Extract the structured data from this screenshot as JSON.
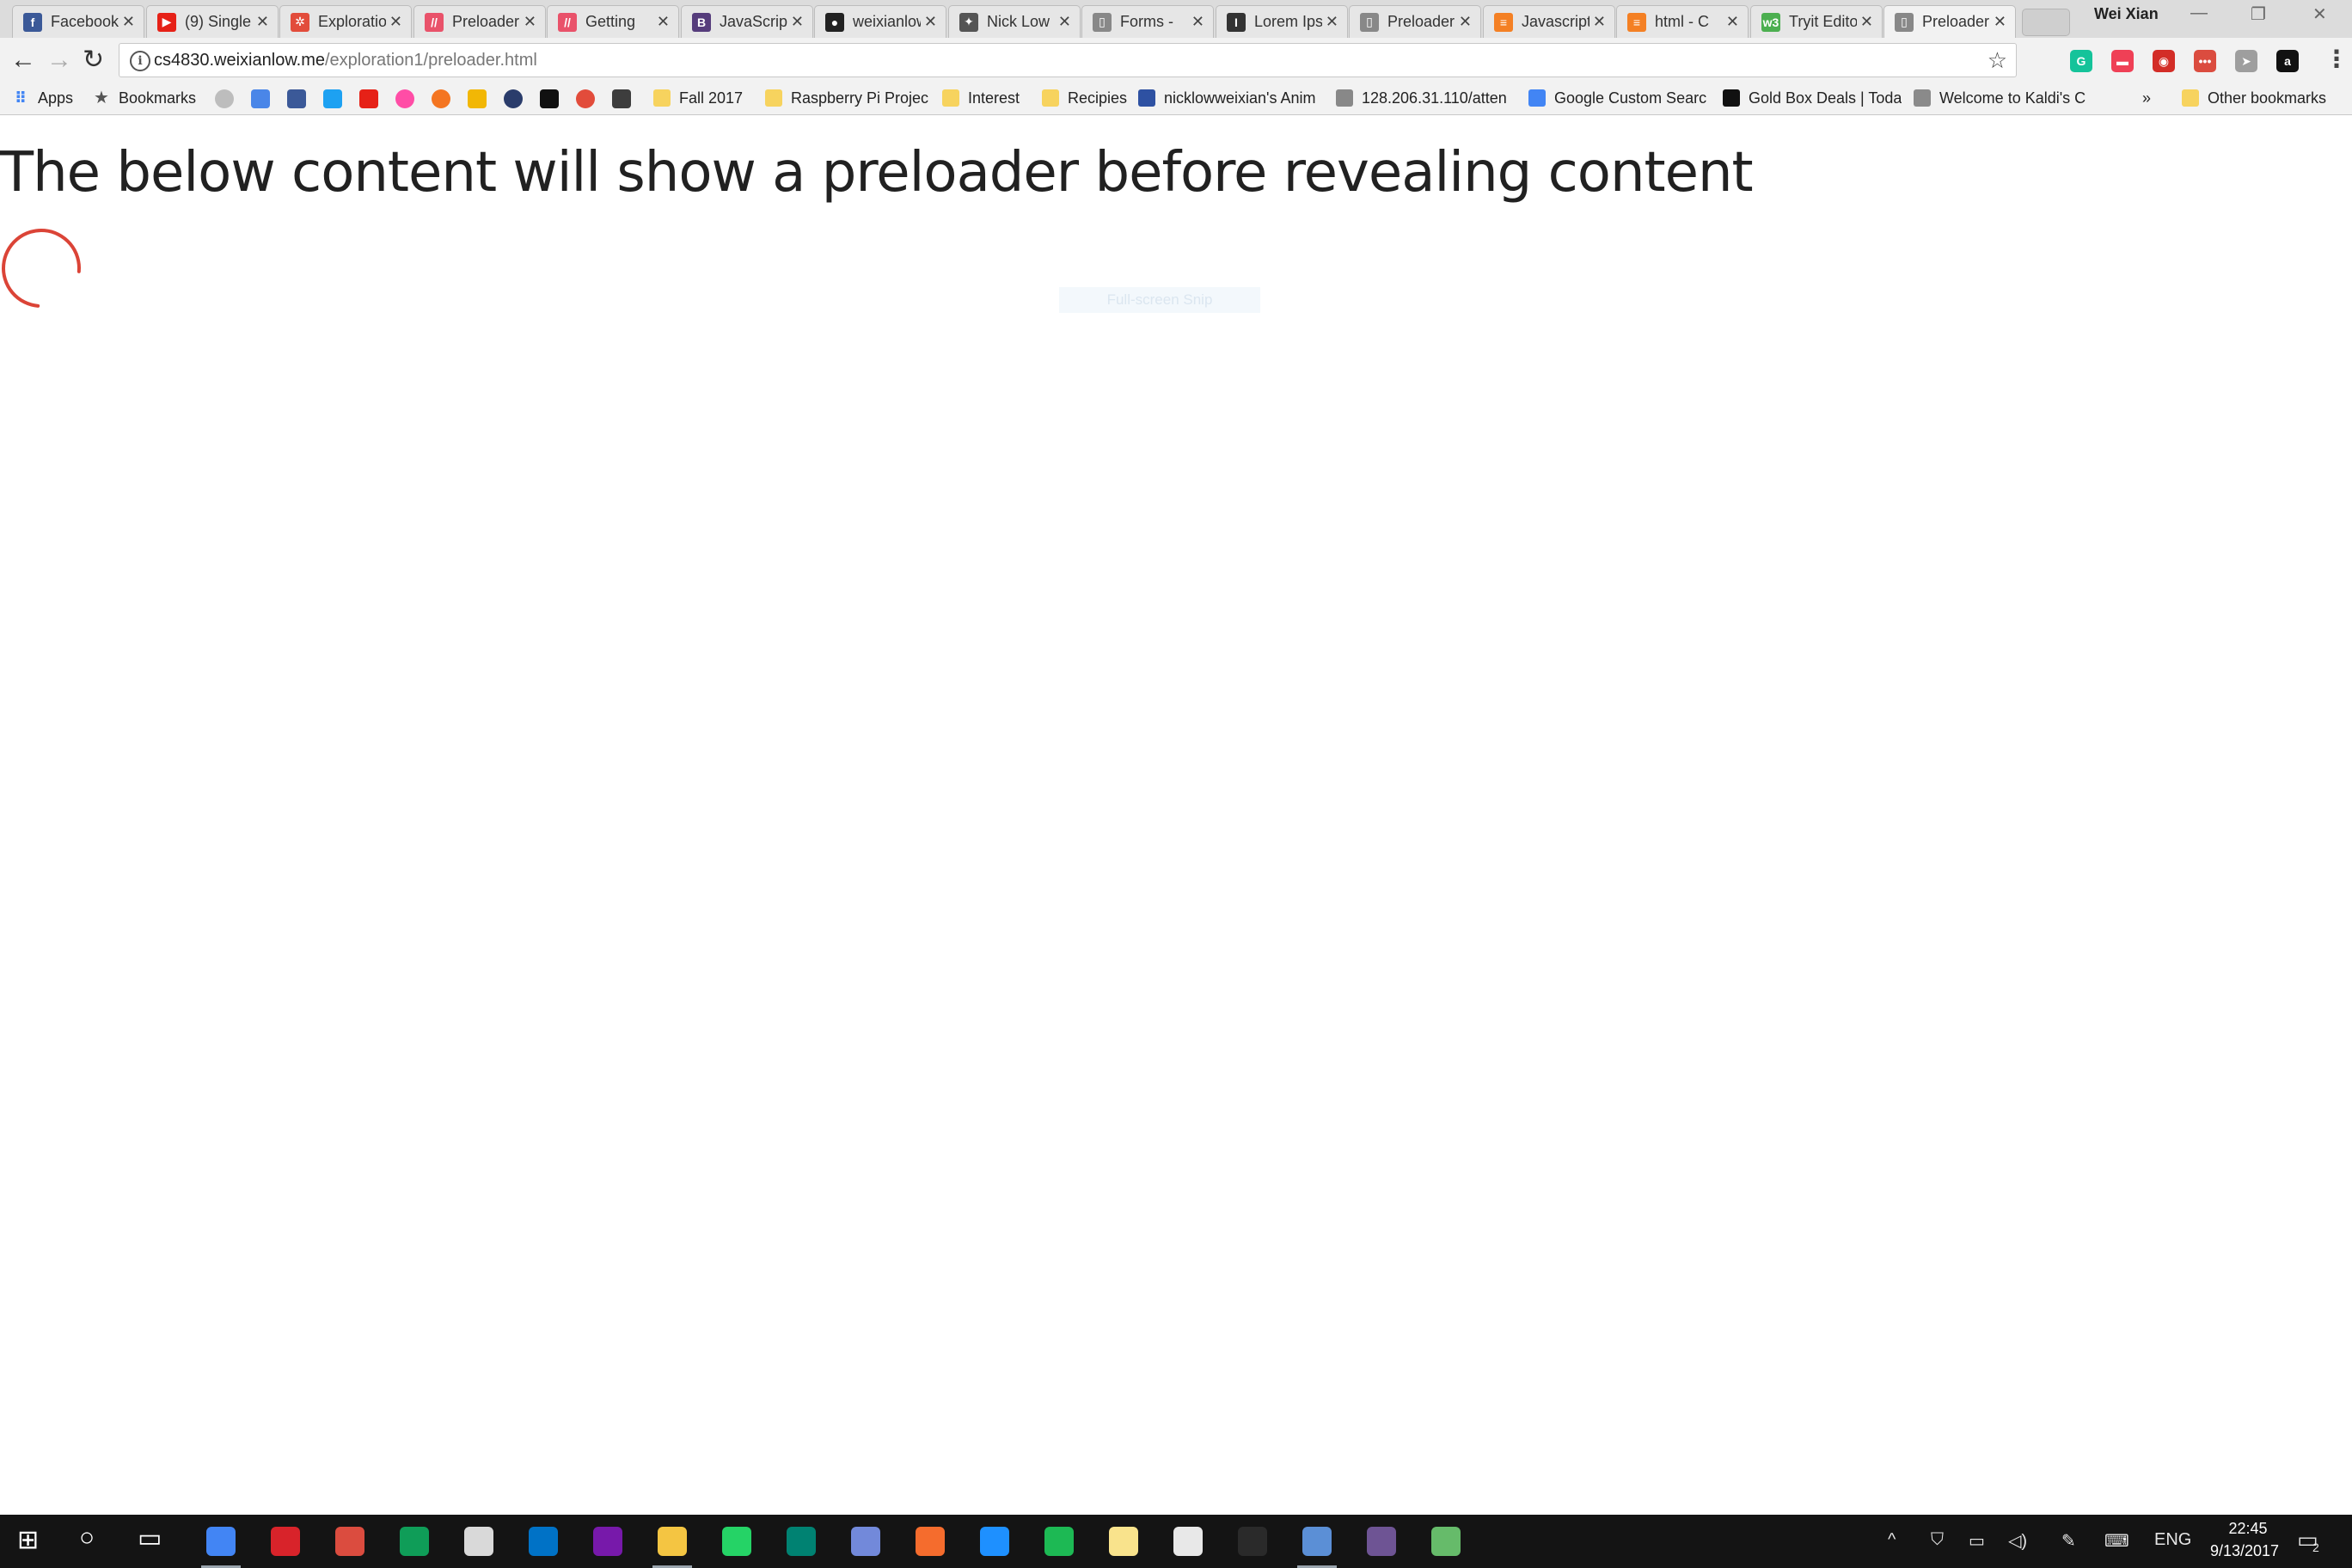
{
  "window": {
    "profile_name": "Wei Xian",
    "minimize_glyph": "—",
    "restore_glyph": "❐",
    "close_glyph": "✕"
  },
  "tabs": [
    {
      "title": "Facebook",
      "icon": "facebook-icon",
      "color": "#3b5998",
      "glyph": "f"
    },
    {
      "title": "(9) Single",
      "icon": "youtube-icon",
      "color": "#e62117",
      "glyph": "▶"
    },
    {
      "title": "Exploration",
      "icon": "lifering-icon",
      "color": "#e24c3b",
      "glyph": "✲"
    },
    {
      "title": "Preloader",
      "icon": "codrops-icon",
      "color": "#e9526a",
      "glyph": "//"
    },
    {
      "title": "Getting",
      "icon": "codrops-icon",
      "color": "#e9526a",
      "glyph": "//"
    },
    {
      "title": "JavaScript",
      "icon": "bootstrap-icon",
      "color": "#563d7c",
      "glyph": "B"
    },
    {
      "title": "weixianlow",
      "icon": "github-icon",
      "color": "#222222",
      "glyph": "●"
    },
    {
      "title": "Nick Low",
      "icon": "star-badge-icon",
      "color": "#555555",
      "glyph": "✦"
    },
    {
      "title": "Forms -",
      "icon": "document-icon",
      "color": "#888888",
      "glyph": "▯"
    },
    {
      "title": "Lorem Ipsum",
      "icon": "lorem-icon",
      "color": "#333333",
      "glyph": "I"
    },
    {
      "title": "Preloader",
      "icon": "document-icon",
      "color": "#888888",
      "glyph": "▯"
    },
    {
      "title": "Javascript",
      "icon": "stackoverflow-icon",
      "color": "#f48024",
      "glyph": "≡"
    },
    {
      "title": "html - C",
      "icon": "stackoverflow-icon",
      "color": "#f48024",
      "glyph": "≡"
    },
    {
      "title": "Tryit Editor",
      "icon": "w3schools-icon",
      "color": "#4caf50",
      "glyph": "w3"
    },
    {
      "title": "Preloader",
      "icon": "document-icon",
      "color": "#888888",
      "glyph": "▯",
      "active": true
    }
  ],
  "toolbar": {
    "back_glyph": "←",
    "forward_glyph": "→",
    "reload_glyph": "↻",
    "url_host": "cs4830.weixianlow.me",
    "url_path": "/exploration1/preloader.html",
    "info_glyph": "i",
    "star_glyph": "☆",
    "menu_glyph": "⋮",
    "extensions": [
      {
        "icon": "grammarly-icon",
        "color": "#15c39a",
        "glyph": "G"
      },
      {
        "icon": "pocket-icon",
        "color": "#ef4056",
        "glyph": "▬"
      },
      {
        "icon": "lastpass-icon",
        "color": "#d32d27",
        "glyph": "◉"
      },
      {
        "icon": "todoist-icon",
        "color": "#db4c3f",
        "glyph": "•••"
      },
      {
        "icon": "arrow-icon",
        "color": "#9e9e9e",
        "glyph": "➤"
      },
      {
        "icon": "amazon-assistant-icon",
        "color": "#111111",
        "glyph": "a"
      }
    ]
  },
  "bookmarks": {
    "apps_label": "Apps",
    "bookmarks_label": "Bookmarks",
    "items": [
      {
        "label": "Fall 2017",
        "type": "folder"
      },
      {
        "label": "Raspberry Pi Project",
        "type": "folder"
      },
      {
        "label": "Interest",
        "type": "folder"
      },
      {
        "label": "Recipies",
        "type": "folder"
      },
      {
        "label": "nicklowweixian's Anim",
        "type": "site",
        "icon": "mal-icon",
        "color": "#2e51a2"
      },
      {
        "label": "128.206.31.110/atten",
        "type": "page",
        "icon": "document-icon",
        "color": "#888888"
      },
      {
        "label": "Google Custom Searc",
        "type": "site",
        "icon": "google-icon",
        "color": "#4285f4"
      },
      {
        "label": "Gold Box Deals | Toda",
        "type": "site",
        "icon": "amazon-icon",
        "color": "#111111"
      },
      {
        "label": "Welcome to Kaldi's C",
        "type": "site",
        "icon": "kaldis-icon",
        "color": "#8a8a8a"
      }
    ],
    "overflow_glyph": "»",
    "other_label": "Other bookmarks"
  },
  "page": {
    "heading": "The below content will show a preloader before revealing content",
    "snip_label": "Full-screen Snip",
    "spinner_color": "#db4437"
  },
  "taskbar": {
    "start_glyph": "⊞",
    "search_glyph": "○",
    "taskview_glyph": "▭",
    "apps": [
      {
        "name": "chrome-icon",
        "color": "#4285f4",
        "running": true
      },
      {
        "name": "acrobat-icon",
        "color": "#d8232a",
        "running": false
      },
      {
        "name": "todoist-icon",
        "color": "#db4c3f",
        "running": false
      },
      {
        "name": "hangouts-icon",
        "color": "#0f9d58",
        "running": false
      },
      {
        "name": "mail-icon",
        "color": "#d9d9d9",
        "running": false
      },
      {
        "name": "outlook-icon",
        "color": "#0072c6",
        "running": false
      },
      {
        "name": "onenote-icon",
        "color": "#7719aa",
        "running": false
      },
      {
        "name": "file-explorer-icon",
        "color": "#f4c542",
        "running": true
      },
      {
        "name": "whatsapp-icon",
        "color": "#25d366",
        "running": false
      },
      {
        "name": "sway-icon",
        "color": "#008272",
        "running": false
      },
      {
        "name": "discord-icon",
        "color": "#7289da",
        "running": false
      },
      {
        "name": "origin-icon",
        "color": "#f56c2d",
        "running": false
      },
      {
        "name": "photos-icon",
        "color": "#1e90ff",
        "running": false
      },
      {
        "name": "spotify-icon",
        "color": "#1db954",
        "running": false
      },
      {
        "name": "sticky-notes-icon",
        "color": "#f9e38c",
        "running": false
      },
      {
        "name": "paint-icon",
        "color": "#e8e8e8",
        "running": false
      },
      {
        "name": "terminal-icon",
        "color": "#2a2a2a",
        "running": false
      },
      {
        "name": "network-icon",
        "color": "#5b8fd6",
        "running": true
      },
      {
        "name": "github-desktop-icon",
        "color": "#6e5494",
        "running": false
      },
      {
        "name": "atom-icon",
        "color": "#66bb6a",
        "running": false
      }
    ],
    "tray": {
      "chevron_glyph": "^",
      "language": "ENG",
      "time": "22:45",
      "date": "9/13/2017",
      "notifications_count": "2"
    }
  }
}
